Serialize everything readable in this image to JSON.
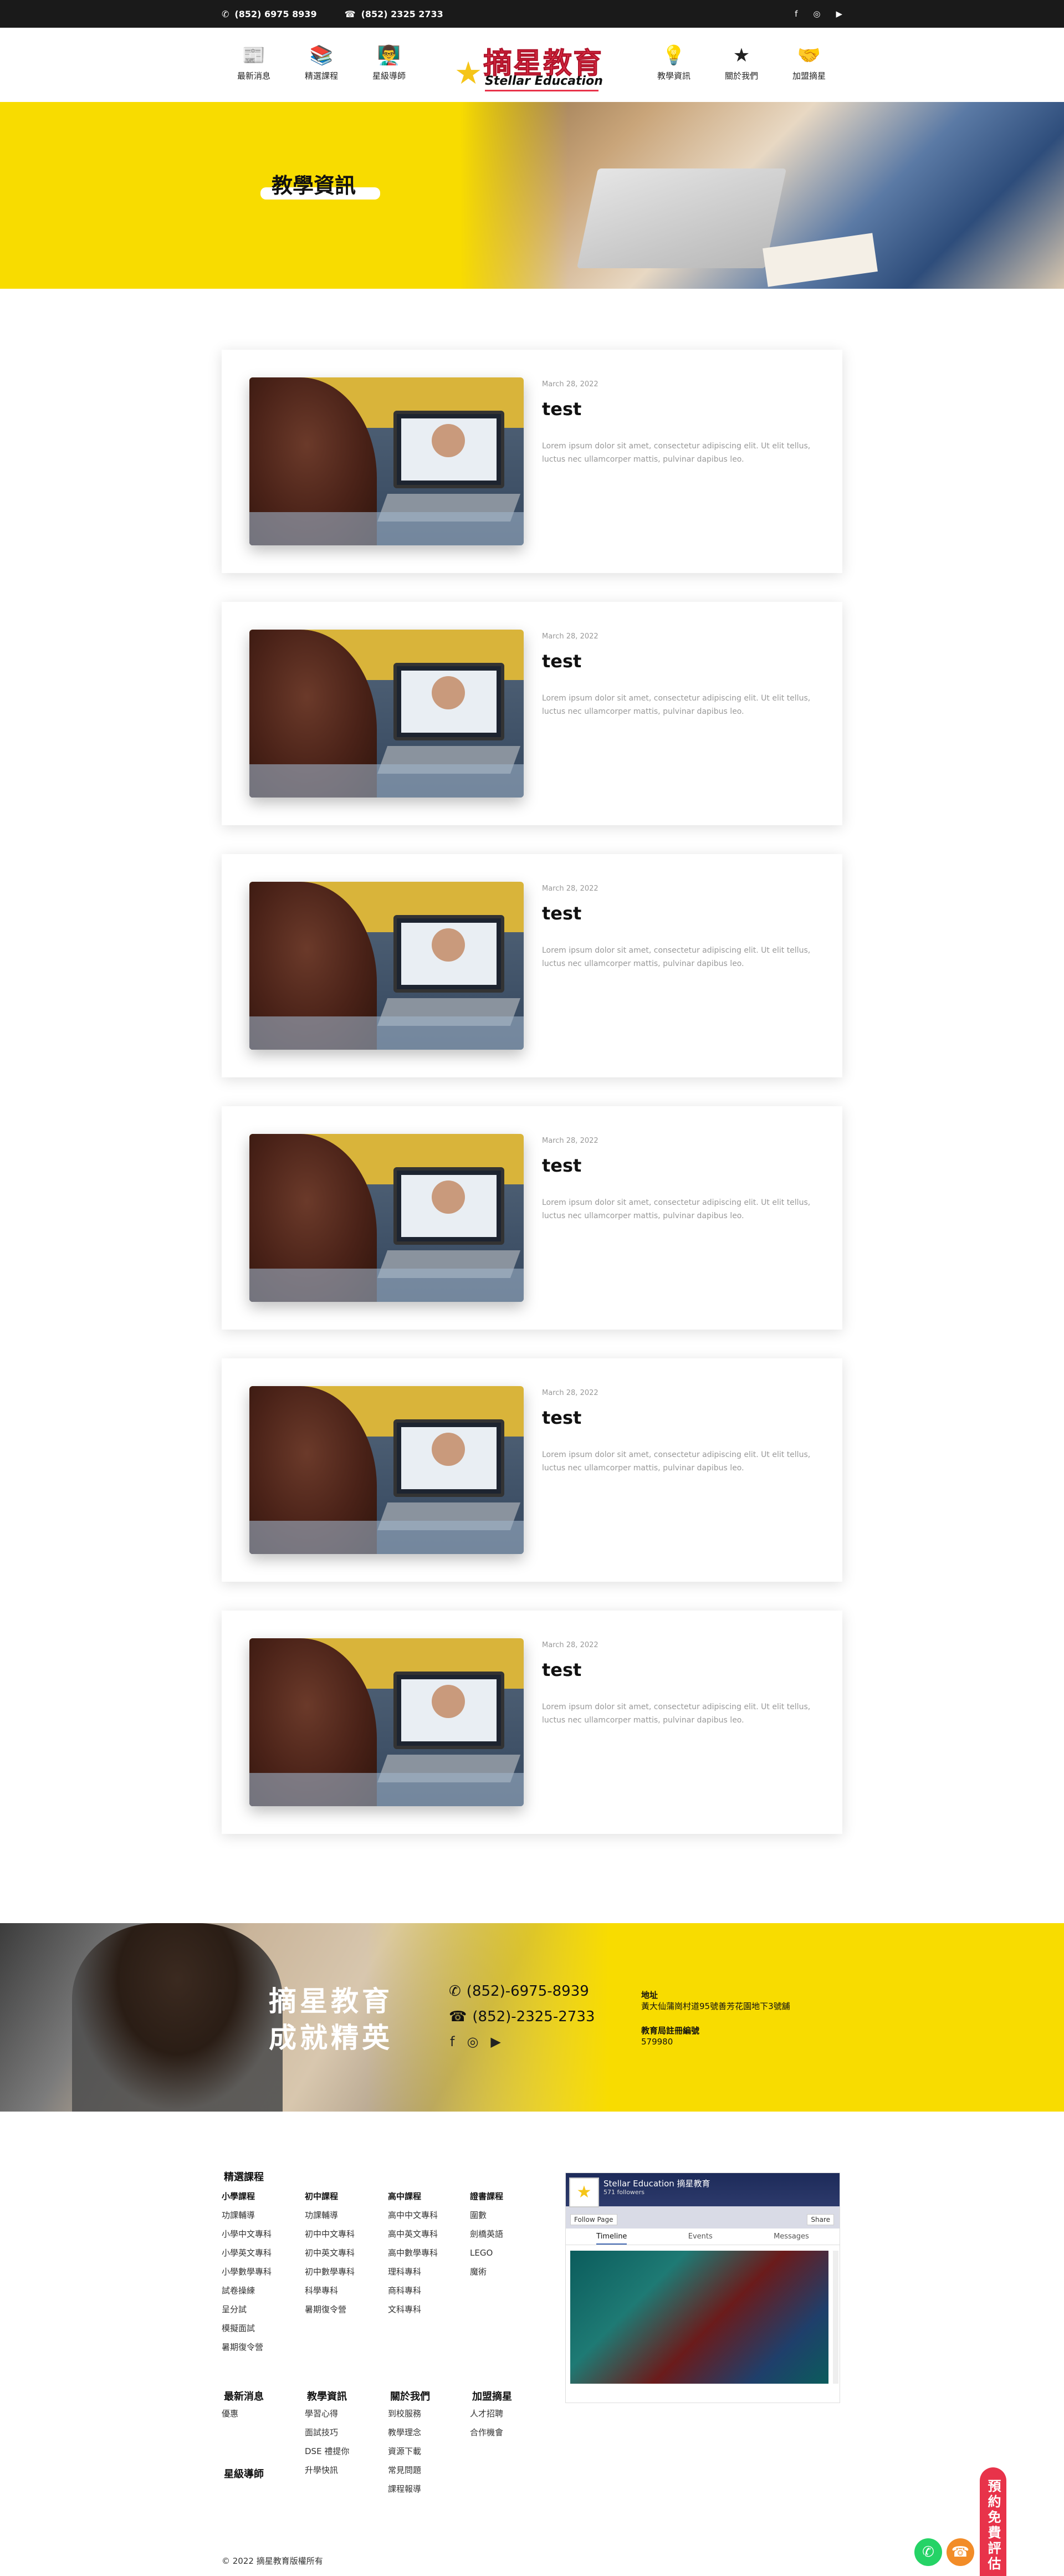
{
  "topbar": {
    "phone1": "(852) 6975 8939",
    "phone2": "(852) 2325 2733",
    "social": [
      "f",
      "◎",
      "▶"
    ]
  },
  "nav": {
    "left": [
      {
        "label": "最新消息",
        "icon": "news-icon"
      },
      {
        "label": "精選課程",
        "icon": "courses-icon"
      },
      {
        "label": "星級導師",
        "icon": "tutor-icon"
      }
    ],
    "right": [
      {
        "label": "教學資訊",
        "icon": "lightbulb-icon"
      },
      {
        "label": "關於我們",
        "icon": "star-icon"
      },
      {
        "label": "加盟摘星",
        "icon": "handshake-icon"
      }
    ]
  },
  "logo": {
    "cn": "摘星教育",
    "en": "Stellar Education"
  },
  "hero": {
    "title": "教學資訊"
  },
  "posts": [
    {
      "date": "March 28, 2022",
      "title": "test",
      "excerpt": "Lorem ipsum dolor sit amet, consectetur adipiscing elit. Ut elit tellus, luctus nec ullamcorper mattis, pulvinar dapibus leo."
    },
    {
      "date": "March 28, 2022",
      "title": "test",
      "excerpt": "Lorem ipsum dolor sit amet, consectetur adipiscing elit. Ut elit tellus, luctus nec ullamcorper mattis, pulvinar dapibus leo."
    },
    {
      "date": "March 28, 2022",
      "title": "test",
      "excerpt": "Lorem ipsum dolor sit amet, consectetur adipiscing elit. Ut elit tellus, luctus nec ullamcorper mattis, pulvinar dapibus leo."
    },
    {
      "date": "March 28, 2022",
      "title": "test",
      "excerpt": "Lorem ipsum dolor sit amet, consectetur adipiscing elit. Ut elit tellus, luctus nec ullamcorper mattis, pulvinar dapibus leo."
    },
    {
      "date": "March 28, 2022",
      "title": "test",
      "excerpt": "Lorem ipsum dolor sit amet, consectetur adipiscing elit. Ut elit tellus, luctus nec ullamcorper mattis, pulvinar dapibus leo."
    },
    {
      "date": "March 28, 2022",
      "title": "test",
      "excerpt": "Lorem ipsum dolor sit amet, consectetur adipiscing elit. Ut elit tellus, luctus nec ullamcorper mattis, pulvinar dapibus leo."
    }
  ],
  "contact": {
    "slogan1": "摘星教育",
    "slogan2": "成就精英",
    "phone1": "(852)-6975-8939",
    "phone2": "(852)-2325-2733",
    "address_label": "地址",
    "address": "黃大仙蒲崗村道95號善芳花園地下3號舖",
    "reg_label": "教育局註冊編號",
    "reg_no": "579980"
  },
  "footer": {
    "courses_title": "精選課程",
    "columns": [
      {
        "heading": "小學課程",
        "items": [
          "功課輔導",
          "小學中文專科",
          "小學英文專科",
          "小學數學專科",
          "試卷操練",
          "呈分試",
          "模擬面試",
          "暑期復令營"
        ]
      },
      {
        "heading": "初中課程",
        "items": [
          "功課輔導",
          "初中中文專科",
          "初中英文專科",
          "初中數學專科",
          "科學專科",
          "暑期復令營"
        ]
      },
      {
        "heading": "高中課程",
        "items": [
          "高中中文專科",
          "高中英文專科",
          "高中數學專科",
          "理科專科",
          "商科專科",
          "文科專科"
        ]
      },
      {
        "heading": "證書課程",
        "items": [
          "圍數",
          "劍橋英語",
          "LEGO",
          "魔術"
        ]
      }
    ],
    "news_title": "最新消息",
    "news_items": [
      "優惠"
    ],
    "info_title": "教學資訊",
    "info_items": [
      "學習心得",
      "面試技巧",
      "DSE 禮提你",
      "升學快訊"
    ],
    "about_title": "關於我們",
    "about_items": [
      "到校服務",
      "教學理念",
      "資源下載",
      "常見問題",
      "課程報導"
    ],
    "join_title": "加盟摘星",
    "join_items": [
      "人才招聘",
      "合作機會"
    ],
    "tutor_title": "星級導師",
    "copyright": "© 2022 摘星教育版權所有"
  },
  "facebook": {
    "page_name": "Stellar Education 摘星教育",
    "likes": "571 followers",
    "follow": "Follow Page",
    "share": "Share",
    "tabs": [
      "Timeline",
      "Events",
      "Messages"
    ]
  },
  "floating": {
    "booking": "預約免費評估"
  },
  "colors": {
    "brand_yellow": "#f8dc00",
    "brand_red": "#e8334a",
    "whatsapp": "#25d366",
    "phone": "#f28c28"
  }
}
